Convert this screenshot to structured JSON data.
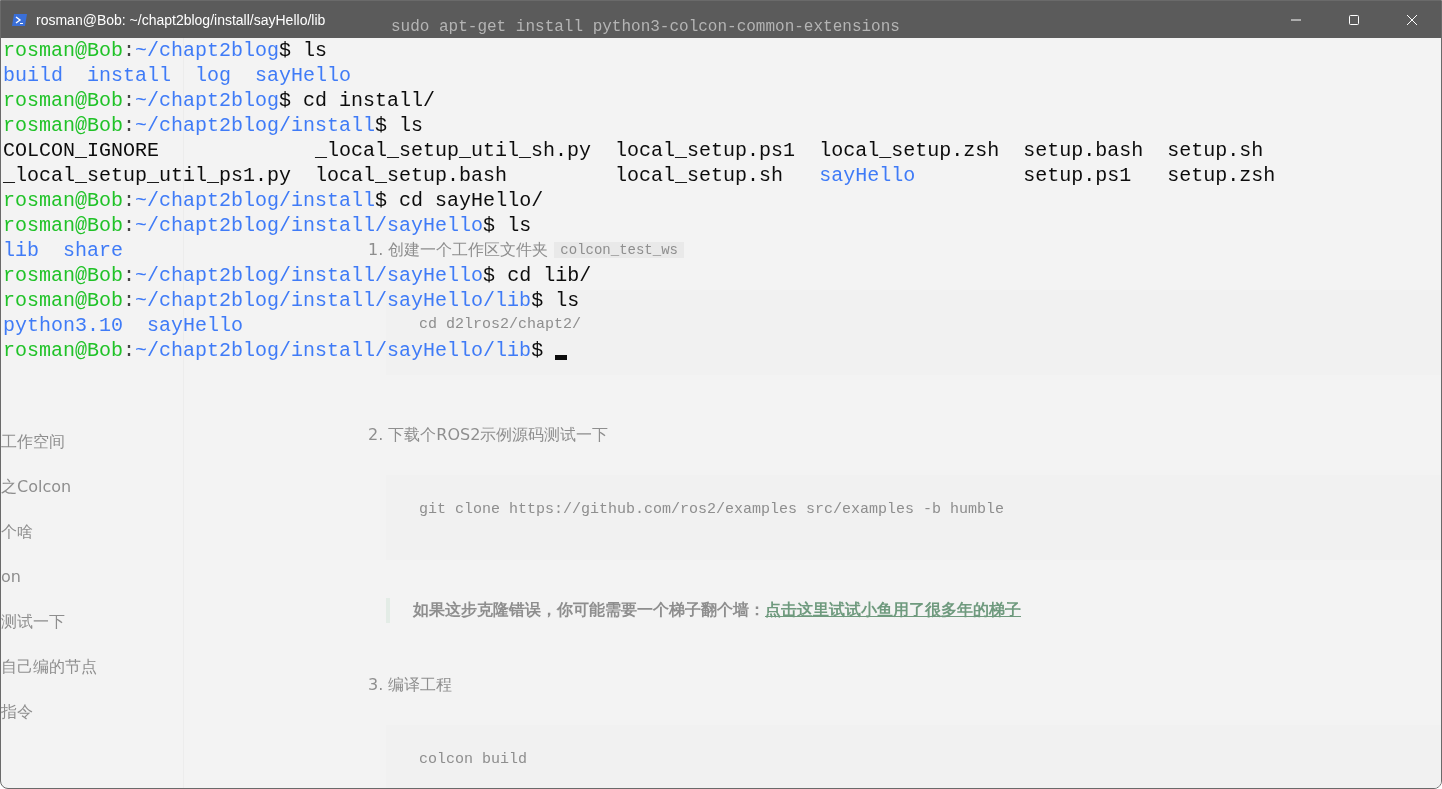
{
  "window": {
    "title": "rosman@Bob: ~/chapt2blog/install/sayHello/lib"
  },
  "terminal": {
    "lines": [
      {
        "user": "rosman@Bob",
        "separator": ":",
        "path": "~/chapt2blog",
        "symbol": "$",
        "command": "ls"
      },
      {
        "rows": [
          [
            {
              "name": "build",
              "kind": "dir"
            },
            {
              "name": "install",
              "kind": "dir"
            },
            {
              "name": "log",
              "kind": "dir"
            },
            {
              "name": "sayHello",
              "kind": "dir"
            }
          ]
        ]
      },
      {
        "user": "rosman@Bob",
        "separator": ":",
        "path": "~/chapt2blog",
        "symbol": "$",
        "command": "cd install/"
      },
      {
        "user": "rosman@Bob",
        "separator": ":",
        "path": "~/chapt2blog/install",
        "symbol": "$",
        "command": "ls"
      },
      {
        "rows": [
          [
            {
              "name": "COLCON_IGNORE",
              "kind": "file"
            },
            {
              "name": "_local_setup_util_sh.py",
              "kind": "file"
            },
            {
              "name": "local_setup.ps1",
              "kind": "file"
            },
            {
              "name": "local_setup.zsh",
              "kind": "file"
            },
            {
              "name": "setup.bash",
              "kind": "file"
            },
            {
              "name": "setup.sh",
              "kind": "file"
            }
          ],
          [
            {
              "name": "_local_setup_util_ps1.py",
              "kind": "file"
            },
            {
              "name": "local_setup.bash",
              "kind": "file"
            },
            {
              "name": "local_setup.sh",
              "kind": "file"
            },
            {
              "name": "sayHello",
              "kind": "dir"
            },
            {
              "name": "setup.ps1",
              "kind": "file"
            },
            {
              "name": "setup.zsh",
              "kind": "file"
            }
          ]
        ]
      },
      {
        "user": "rosman@Bob",
        "separator": ":",
        "path": "~/chapt2blog/install",
        "symbol": "$",
        "command": "cd sayHello/"
      },
      {
        "user": "rosman@Bob",
        "separator": ":",
        "path": "~/chapt2blog/install/sayHello",
        "symbol": "$",
        "command": "ls"
      },
      {
        "rows": [
          [
            {
              "name": "lib",
              "kind": "dir"
            },
            {
              "name": "share",
              "kind": "dir"
            }
          ]
        ]
      },
      {
        "user": "rosman@Bob",
        "separator": ":",
        "path": "~/chapt2blog/install/sayHello",
        "symbol": "$",
        "command": "cd lib/"
      },
      {
        "user": "rosman@Bob",
        "separator": ":",
        "path": "~/chapt2blog/install/sayHello/lib",
        "symbol": "$",
        "command": "ls"
      },
      {
        "rows": [
          [
            {
              "name": "python3.10",
              "kind": "dir"
            },
            {
              "name": "sayHello",
              "kind": "dir"
            }
          ]
        ]
      },
      {
        "user": "rosman@Bob",
        "separator": ":",
        "path": "~/chapt2blog/install/sayHello/lib",
        "symbol": "$",
        "cursor": true
      }
    ]
  },
  "background_page": {
    "command_line": "sudo apt-get install python3-colcon-common-extensions",
    "sidebar_items": [
      "工作空间",
      "之Colcon",
      "个啥",
      "on",
      "测试一下",
      "自己编的节点",
      "指令"
    ],
    "blocks": [
      {
        "kind": "step",
        "text": "1. 创建一个工作区文件夹",
        "code": "colcon_test_ws"
      },
      {
        "kind": "code",
        "text": "cd d2lros2/chapt2/"
      },
      {
        "kind": "step",
        "text": "2. 下载个ROS2示例源码测试一下"
      },
      {
        "kind": "code",
        "text": "git clone https://github.com/ros2/examples src/examples -b humble"
      },
      {
        "kind": "note",
        "text": "如果这步克隆错误，你可能需要一个梯子翻个墙：",
        "link": "点击这里试试小鱼用了很多年的梯子"
      },
      {
        "kind": "step",
        "text": "3. 编译工程"
      },
      {
        "kind": "code",
        "text": "colcon build"
      }
    ]
  }
}
